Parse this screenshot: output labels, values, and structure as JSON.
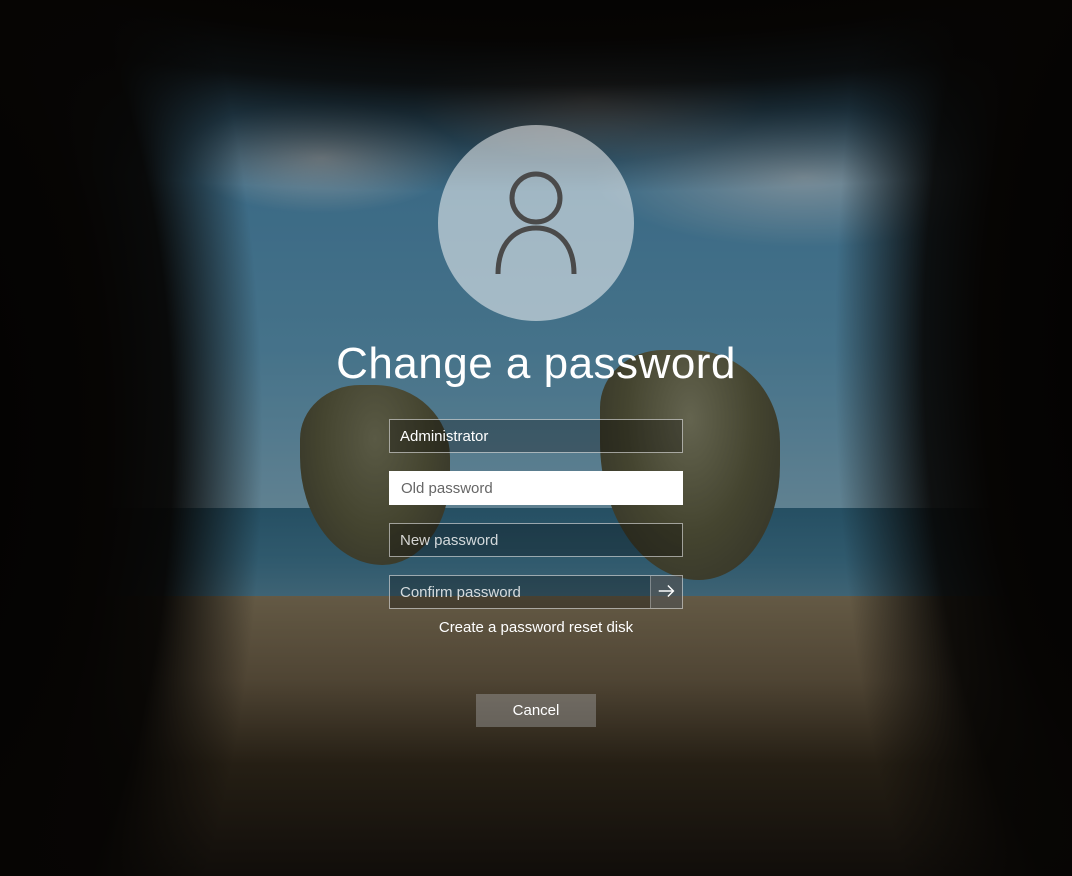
{
  "title": "Change a password",
  "username": {
    "value": "Administrator"
  },
  "old_password": {
    "placeholder": "Old password",
    "value": ""
  },
  "new_password": {
    "placeholder": "New password",
    "value": ""
  },
  "confirm_password": {
    "placeholder": "Confirm password",
    "value": ""
  },
  "reset_link": "Create a password reset disk",
  "cancel_label": "Cancel",
  "icons": {
    "user": "user-icon",
    "submit": "arrow-right-icon"
  }
}
